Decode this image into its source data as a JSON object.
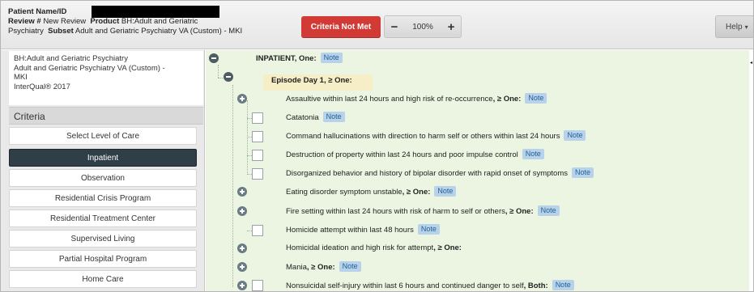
{
  "header": {
    "patient_label": "Patient Name/ID",
    "review_label": "Review #",
    "review_value": "New Review",
    "product_label": "Product",
    "product_value_line1": "BH:Adult and Geriatric",
    "product_value_line2": "Psychiatry",
    "subset_label": "Subset",
    "subset_value": "Adult and Geriatric Psychiatry VA (Custom) - MKI",
    "criteria_status": "Criteria Not Met",
    "zoom_out": "−",
    "zoom_level": "100%",
    "zoom_in": "+",
    "help_label": "Help",
    "help_caret": "▾"
  },
  "sidebar": {
    "product_info": {
      "line1": "BH:Adult and Geriatric Psychiatry",
      "line2": "Adult and Geriatric Psychiatry VA (Custom) -",
      "line3": "MKI",
      "line4": "InterQual® 2017"
    },
    "criteria_title": "Criteria",
    "select_level_label": "Select Level of Care",
    "levels": [
      {
        "label": "Inpatient",
        "selected": true
      },
      {
        "label": "Observation",
        "selected": false
      },
      {
        "label": "Residential Crisis Program",
        "selected": false
      },
      {
        "label": "Residential Treatment Center",
        "selected": false
      },
      {
        "label": "Supervised Living",
        "selected": false
      },
      {
        "label": "Partial Hospital Program",
        "selected": false
      },
      {
        "label": "Home Care",
        "selected": false
      }
    ]
  },
  "tree": {
    "note_label": "Note",
    "root": {
      "title": "INPATIENT",
      "qualifier": ", One:"
    },
    "episode": {
      "title": "Episode Day 1",
      "qualifier": ", ≥ One:"
    },
    "items": [
      {
        "text": "Assaultive within last 24 hours and high risk of re-occurrence",
        "qualifier": ", ≥ One:",
        "control": "plus",
        "note": true
      },
      {
        "text": "Catatonia",
        "qualifier": "",
        "control": "checkbox",
        "note": true
      },
      {
        "text": "Command hallucinations with direction to harm self or others within last 24 hours",
        "qualifier": "",
        "control": "checkbox",
        "note": true
      },
      {
        "text": "Destruction of property within last 24 hours and poor impulse control",
        "qualifier": "",
        "control": "checkbox",
        "note": true
      },
      {
        "text": "Disorganized behavior and history of bipolar disorder with rapid onset of symptoms",
        "qualifier": "",
        "control": "checkbox",
        "note": true
      },
      {
        "text": "Eating disorder symptom unstable",
        "qualifier": ", ≥ One:",
        "control": "plus",
        "note": true
      },
      {
        "text": "Fire setting within last 24 hours with risk of harm to self or others",
        "qualifier": ", ≥ One:",
        "control": "plus",
        "note": true
      },
      {
        "text": "Homicide attempt within last 48 hours",
        "qualifier": "",
        "control": "checkbox",
        "note": true
      },
      {
        "text": "Homicidal ideation and high risk for attempt",
        "qualifier": ", ≥ One:",
        "control": "plus",
        "note": false
      },
      {
        "text": "Mania",
        "qualifier": ", ≥ One:",
        "control": "plus",
        "note": true
      },
      {
        "text": "Nonsuicidal self-injury within last 6 hours and continued danger to self",
        "qualifier": ", Both:",
        "control": "plus-checkbox",
        "note": true
      }
    ]
  },
  "colors": {
    "criteria_status_bg": "#d23a36",
    "selected_level_bg": "#2f3e47",
    "tree_bg": "#ebf5e1",
    "episode_bg": "#f5eec7",
    "note_bg": "#b8d2ea"
  }
}
